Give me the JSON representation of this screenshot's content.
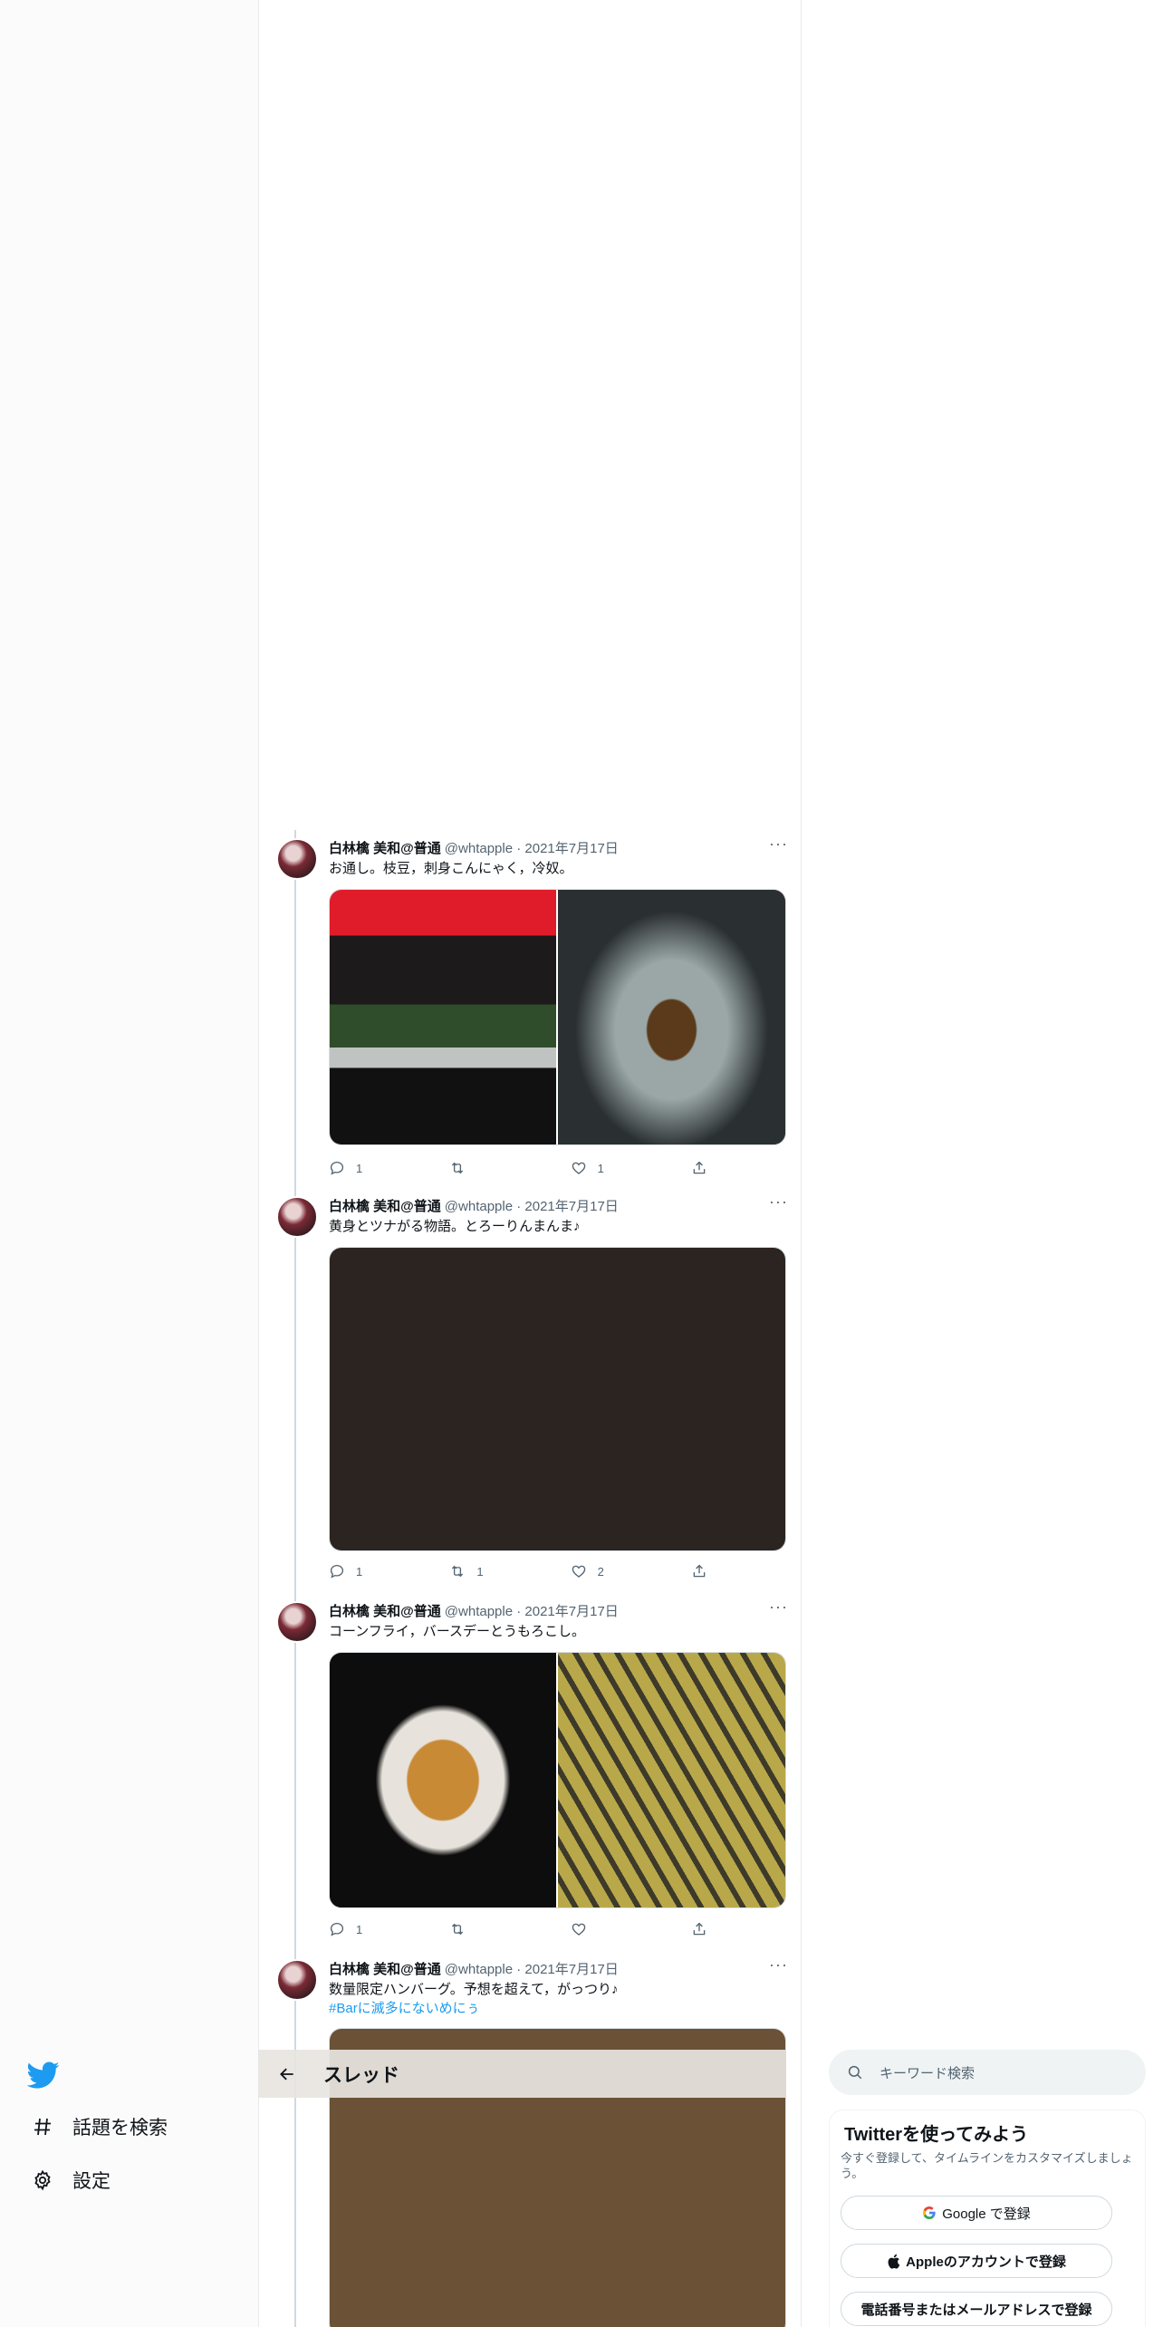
{
  "nav": {
    "items": [
      {
        "label": "話題を検索",
        "icon": "hashtag-icon"
      },
      {
        "label": "設定",
        "icon": "gear-icon"
      }
    ]
  },
  "header": {
    "title": "スレッド"
  },
  "search": {
    "placeholder": "キーワード検索"
  },
  "signup": {
    "title": "Twitterを使ってみよう",
    "subtitle": "今すぐ登録して、タイムラインをカスタマイズしましょう。",
    "google_label": "Google で登録",
    "apple_label": "Appleのアカウントで登録",
    "phone_label": "電話番号またはメールアドレスで登録"
  },
  "tweets": [
    {
      "name": "白林檎 美和@普通",
      "handle": "@whtapple · 2021年7月17日",
      "text": "お通し。枝豆，刺身こんにゃく，冷奴。",
      "hashtag": "",
      "reply": "1",
      "retweet": "",
      "like": "1"
    },
    {
      "name": "白林檎 美和@普通",
      "handle": "@whtapple · 2021年7月17日",
      "text": "黄身とツナがる物語。とろーりんまんま♪",
      "hashtag": "",
      "reply": "1",
      "retweet": "1",
      "like": "2"
    },
    {
      "name": "白林檎 美和@普通",
      "handle": "@whtapple · 2021年7月17日",
      "text": "コーンフライ，バースデーとうもろこし。",
      "hashtag": "",
      "reply": "1",
      "retweet": "",
      "like": ""
    },
    {
      "name": "白林檎 美和@普通",
      "handle": "@whtapple · 2021年7月17日",
      "text": "数量限定ハンバーグ。予想を超えて，がっつり♪",
      "hashtag": "#Barに滅多にないめにぅ",
      "reply": "",
      "retweet": "",
      "like": ""
    }
  ],
  "colors": {
    "accent": "#1d9bf0",
    "text": "#0f1419",
    "muted": "#536471"
  }
}
